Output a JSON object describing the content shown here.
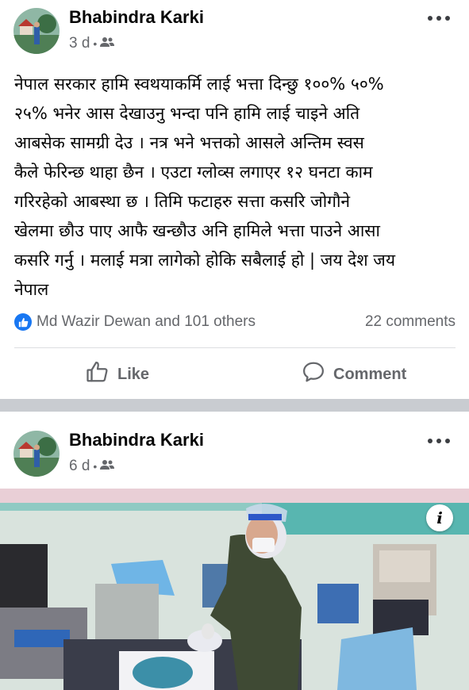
{
  "posts": [
    {
      "author": "Bhabindra Karki",
      "time": "3 d",
      "audience_icon": "friends-icon",
      "text_lines": [
        "नेपाल  सरकार  हामि स्वथयाकर्मि लाई भत्ता दिन्छु १००%  ५०%",
        "२५% भनेर आस देखाउनु भन्दा पनि हामि  लाई चाइने अति",
        "आबसेक सामग्री देउ  । नत्र  भने  भत्तको आसले  अन्तिम स्वस",
        "कैले  फेरिन्छ थाहा  छैन । एउटा ग्लोव्स लगाएर १२ घनटा काम",
        "गरिरहेको आबस्था छ  ।  तिमि फटाहरु  सत्ता कसरि  जोगौने",
        "खेलमा छौउ  पाए आफै खन्छौउ अनि हामिले भत्ता पाउने आसा",
        "कसरि गर्नु  । मलाई मत्रा लागेको होकि सबैलाई हो | जय देश जय",
        "नेपाल"
      ],
      "reactions_text": "Md Wazir Dewan and 101 others",
      "comments_text": "22 comments",
      "actions": {
        "like": "Like",
        "comment": "Comment"
      }
    },
    {
      "author": "Bhabindra Karki",
      "time": "6 d",
      "audience_icon": "friends-icon",
      "photo_info": "i"
    }
  ],
  "colors": {
    "primary_text": "#050505",
    "secondary_text": "#65676b",
    "like_blue": "#1877f2",
    "separator": "#c9ccd1"
  }
}
